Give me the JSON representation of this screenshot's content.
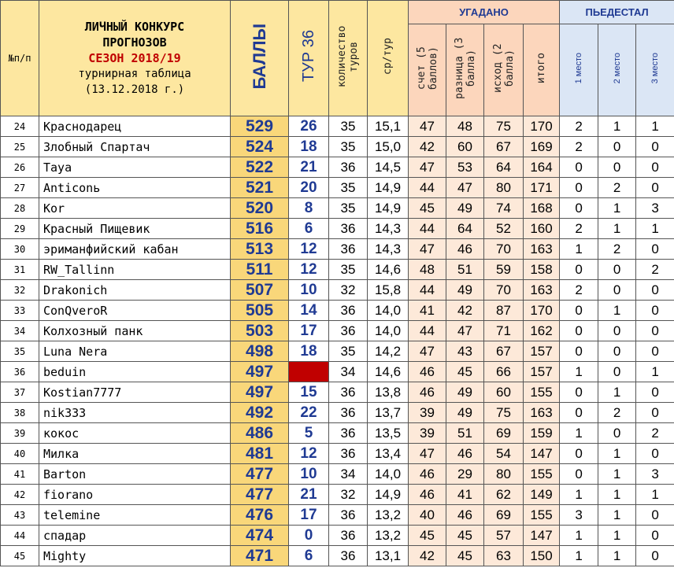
{
  "header": {
    "num_label": "№п/п",
    "title_line1": "ЛИЧНЫЙ КОНКУРС",
    "title_line2": "ПРОГНОЗОВ",
    "season": "СЕЗОН 2018/19",
    "subtitle": "турнирная таблица",
    "date": "(13.12.2018 г.)",
    "points": "БАЛЛЫ",
    "tour": "ТУР 36",
    "tours_count": "количество туров",
    "avg": "ср/тур",
    "guessed_group": "УГАДАНО",
    "score": "счет (5 баллов)",
    "diff": "разница (3 балла)",
    "outcome": "исход (2 балла)",
    "total": "итого",
    "podium_group": "ПЬЕДЕСТАЛ",
    "place1": "1 место",
    "place2": "2 место",
    "place3": "3 место"
  },
  "rows": [
    {
      "rank": "24",
      "name": "Краснодарец",
      "points": "529",
      "tour": "26",
      "tours": "35",
      "avg": "15,1",
      "score": "47",
      "diff": "48",
      "outcome": "75",
      "total": "170",
      "p1": "2",
      "p2": "1",
      "p3": "1"
    },
    {
      "rank": "25",
      "name": "Злобный Спартач",
      "points": "524",
      "tour": "18",
      "tours": "35",
      "avg": "15,0",
      "score": "42",
      "diff": "60",
      "outcome": "67",
      "total": "169",
      "p1": "2",
      "p2": "0",
      "p3": "0"
    },
    {
      "rank": "26",
      "name": "Taya",
      "points": "522",
      "tour": "21",
      "tours": "36",
      "avg": "14,5",
      "score": "47",
      "diff": "53",
      "outcome": "64",
      "total": "164",
      "p1": "0",
      "p2": "0",
      "p3": "0"
    },
    {
      "rank": "27",
      "name": "Anticonь",
      "points": "521",
      "tour": "20",
      "tours": "35",
      "avg": "14,9",
      "score": "44",
      "diff": "47",
      "outcome": "80",
      "total": "171",
      "p1": "0",
      "p2": "2",
      "p3": "0"
    },
    {
      "rank": "28",
      "name": "Kor",
      "points": "520",
      "tour": "8",
      "tours": "35",
      "avg": "14,9",
      "score": "45",
      "diff": "49",
      "outcome": "74",
      "total": "168",
      "p1": "0",
      "p2": "1",
      "p3": "3"
    },
    {
      "rank": "29",
      "name": "Красный Пищевик",
      "points": "516",
      "tour": "6",
      "tours": "36",
      "avg": "14,3",
      "score": "44",
      "diff": "64",
      "outcome": "52",
      "total": "160",
      "p1": "2",
      "p2": "1",
      "p3": "1"
    },
    {
      "rank": "30",
      "name": "эриманфийский кабан",
      "points": "513",
      "tour": "12",
      "tours": "36",
      "avg": "14,3",
      "score": "47",
      "diff": "46",
      "outcome": "70",
      "total": "163",
      "p1": "1",
      "p2": "2",
      "p3": "0"
    },
    {
      "rank": "31",
      "name": "RW_Tallinn",
      "points": "511",
      "tour": "12",
      "tours": "35",
      "avg": "14,6",
      "score": "48",
      "diff": "51",
      "outcome": "59",
      "total": "158",
      "p1": "0",
      "p2": "0",
      "p3": "2"
    },
    {
      "rank": "32",
      "name": "Drakonich",
      "points": "507",
      "tour": "10",
      "tours": "32",
      "avg": "15,8",
      "score": "44",
      "diff": "49",
      "outcome": "70",
      "total": "163",
      "p1": "2",
      "p2": "0",
      "p3": "0"
    },
    {
      "rank": "33",
      "name": "ConQveroR",
      "points": "505",
      "tour": "14",
      "tours": "36",
      "avg": "14,0",
      "score": "41",
      "diff": "42",
      "outcome": "87",
      "total": "170",
      "p1": "0",
      "p2": "1",
      "p3": "0"
    },
    {
      "rank": "34",
      "name": "Колхозный панк",
      "points": "503",
      "tour": "17",
      "tours": "36",
      "avg": "14,0",
      "score": "44",
      "diff": "47",
      "outcome": "71",
      "total": "162",
      "p1": "0",
      "p2": "0",
      "p3": "0"
    },
    {
      "rank": "35",
      "name": "Luna Nera",
      "points": "498",
      "tour": "18",
      "tours": "35",
      "avg": "14,2",
      "score": "47",
      "diff": "43",
      "outcome": "67",
      "total": "157",
      "p1": "0",
      "p2": "0",
      "p3": "0"
    },
    {
      "rank": "36",
      "name": "beduin",
      "points": "497",
      "tour": "",
      "tours": "34",
      "avg": "14,6",
      "score": "46",
      "diff": "45",
      "outcome": "66",
      "total": "157",
      "p1": "1",
      "p2": "0",
      "p3": "1",
      "missed": true
    },
    {
      "rank": "37",
      "name": "Kostian7777",
      "points": "497",
      "tour": "15",
      "tours": "36",
      "avg": "13,8",
      "score": "46",
      "diff": "49",
      "outcome": "60",
      "total": "155",
      "p1": "0",
      "p2": "1",
      "p3": "0"
    },
    {
      "rank": "38",
      "name": "nik333",
      "points": "492",
      "tour": "22",
      "tours": "36",
      "avg": "13,7",
      "score": "39",
      "diff": "49",
      "outcome": "75",
      "total": "163",
      "p1": "0",
      "p2": "2",
      "p3": "0"
    },
    {
      "rank": "39",
      "name": "кокос",
      "points": "486",
      "tour": "5",
      "tours": "36",
      "avg": "13,5",
      "score": "39",
      "diff": "51",
      "outcome": "69",
      "total": "159",
      "p1": "1",
      "p2": "0",
      "p3": "2"
    },
    {
      "rank": "40",
      "name": "Милка",
      "points": "481",
      "tour": "12",
      "tours": "36",
      "avg": "13,4",
      "score": "47",
      "diff": "46",
      "outcome": "54",
      "total": "147",
      "p1": "0",
      "p2": "1",
      "p3": "0"
    },
    {
      "rank": "41",
      "name": "Barton",
      "points": "477",
      "tour": "10",
      "tours": "34",
      "avg": "14,0",
      "score": "46",
      "diff": "29",
      "outcome": "80",
      "total": "155",
      "p1": "0",
      "p2": "1",
      "p3": "3"
    },
    {
      "rank": "42",
      "name": "fiorano",
      "points": "477",
      "tour": "21",
      "tours": "32",
      "avg": "14,9",
      "score": "46",
      "diff": "41",
      "outcome": "62",
      "total": "149",
      "p1": "1",
      "p2": "1",
      "p3": "1"
    },
    {
      "rank": "43",
      "name": "telemine",
      "points": "476",
      "tour": "17",
      "tours": "36",
      "avg": "13,2",
      "score": "40",
      "diff": "46",
      "outcome": "69",
      "total": "155",
      "p1": "3",
      "p2": "1",
      "p3": "0"
    },
    {
      "rank": "44",
      "name": "спадар",
      "points": "474",
      "tour": "0",
      "tours": "36",
      "avg": "13,2",
      "score": "45",
      "diff": "45",
      "outcome": "57",
      "total": "147",
      "p1": "1",
      "p2": "1",
      "p3": "0"
    },
    {
      "rank": "45",
      "name": "Mighty",
      "points": "471",
      "tour": "6",
      "tours": "36",
      "avg": "13,1",
      "score": "42",
      "diff": "45",
      "outcome": "63",
      "total": "150",
      "p1": "1",
      "p2": "1",
      "p3": "0"
    }
  ],
  "colors": {
    "header_bg": "#fde7a0",
    "points_bg": "#f9d77a",
    "guessed_bg": "#fde9d9",
    "podium_header_bg": "#dbe6f5",
    "missed_tour": "#c00000",
    "accent_text": "#1f3a93"
  }
}
